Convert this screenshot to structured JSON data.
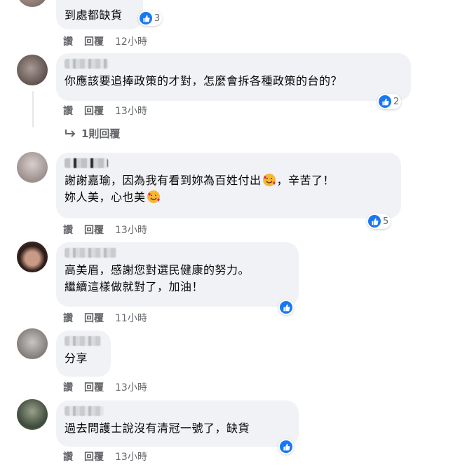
{
  "colors": {
    "bubble": "#f0f2f5",
    "meta_text": "#65676b",
    "like_blue": "#1877f2"
  },
  "comments": [
    {
      "text_lines": [
        "到處都缺貨"
      ],
      "actions": {
        "like": "讚",
        "reply": "回覆",
        "time": "12小時"
      },
      "reactions": {
        "icon": "like-icon",
        "count": "3"
      }
    },
    {
      "text_lines": [
        "你應該要追捧政策的才對，怎麼會拆各種政策的台的？"
      ],
      "actions": {
        "like": "讚",
        "reply": "回覆",
        "time": "13小時"
      },
      "reactions": {
        "icon": "like-icon",
        "count": "2"
      },
      "replies": {
        "icon": "reply-arrow-icon",
        "label": "1則回覆"
      }
    },
    {
      "text_lines": [
        "謝謝嘉瑜，因為我有看到妳為百姓付出",
        "，辛苦了！",
        "妳人美，心也美"
      ],
      "emoji": "smiling-face-with-hearts-icon",
      "actions": {
        "like": "讚",
        "reply": "回覆",
        "time": "13小時"
      },
      "reactions": {
        "icon": "like-icon",
        "count": "5"
      }
    },
    {
      "text_lines": [
        "高美眉，感謝您對選民健康的努力。",
        "繼續這樣做就對了，加油！"
      ],
      "actions": {
        "like": "讚",
        "reply": "回覆",
        "time": "11小時"
      },
      "reactions": {
        "icon": "like-icon",
        "count": ""
      }
    },
    {
      "text_lines": [
        "分享"
      ],
      "actions": {
        "like": "讚",
        "reply": "回覆",
        "time": "13小時"
      }
    },
    {
      "text_lines": [
        "過去問護士說沒有清冠一號了，缺貨"
      ],
      "actions": {
        "like": "讚",
        "reply": "回覆",
        "time": "13小時"
      },
      "reactions": {
        "icon": "like-icon",
        "count": ""
      }
    }
  ]
}
